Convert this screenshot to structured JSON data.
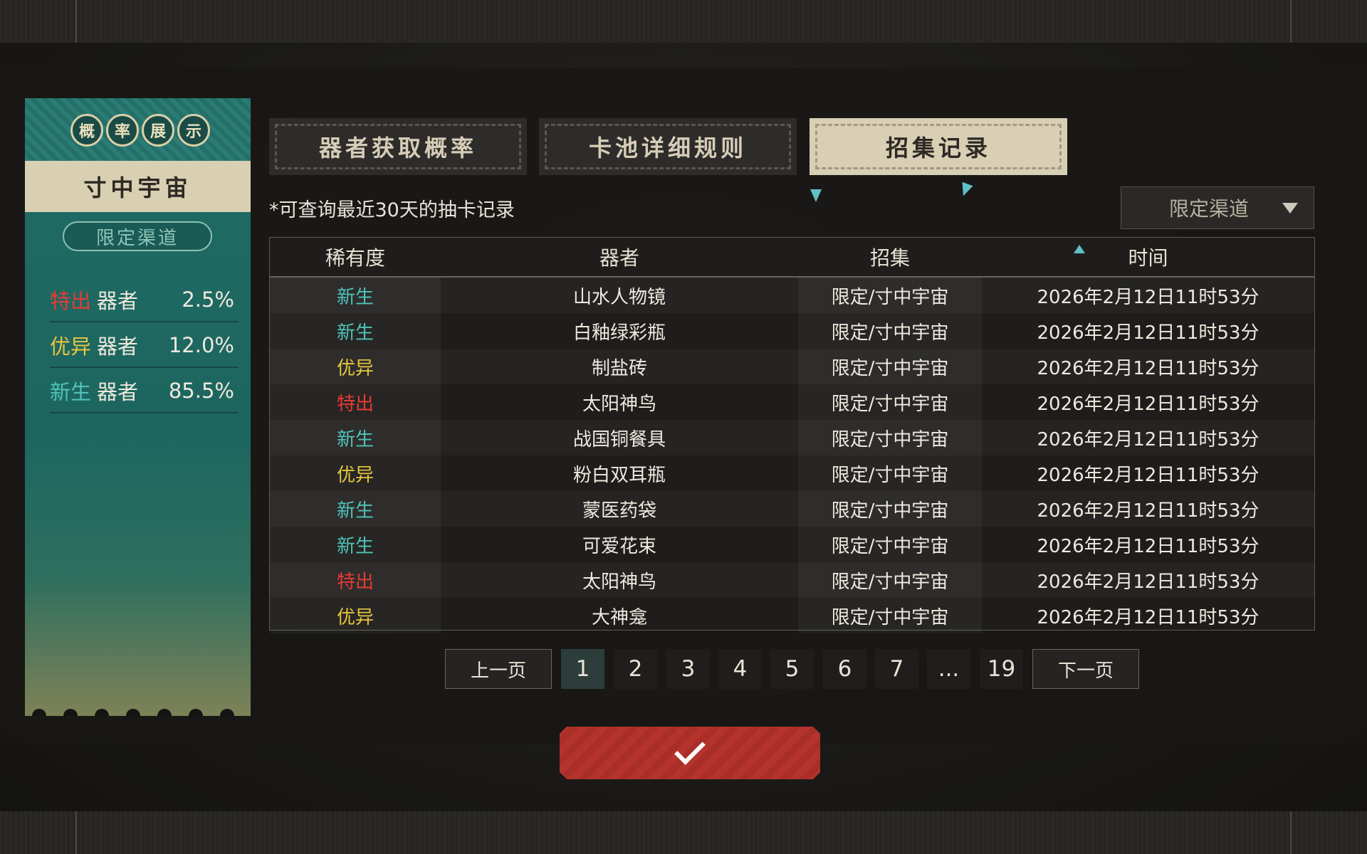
{
  "left_panel": {
    "orbs": [
      "概",
      "率",
      "展",
      "示"
    ],
    "pool_name": "寸中宇宙",
    "channel": "限定渠道",
    "rates": [
      {
        "rarity": "特出",
        "noun": "器者",
        "value": "2.5%"
      },
      {
        "rarity": "优异",
        "noun": "器者",
        "value": "12.0%"
      },
      {
        "rarity": "新生",
        "noun": "器者",
        "value": "85.5%"
      }
    ]
  },
  "tabs": [
    {
      "label": "器者获取概率",
      "active": false
    },
    {
      "label": "卡池详细规则",
      "active": false
    },
    {
      "label": "招集记录",
      "active": true
    }
  ],
  "note": "*可查询最近30天的抽卡记录",
  "channel_select": {
    "selected": "限定渠道"
  },
  "table": {
    "headers": [
      "稀有度",
      "器者",
      "招集",
      "时间"
    ],
    "rows": [
      {
        "rarity": "新生",
        "name": "山水人物镜",
        "pool": "限定/寸中宇宙",
        "time": "2026年2月12日11时53分"
      },
      {
        "rarity": "新生",
        "name": "白釉绿彩瓶",
        "pool": "限定/寸中宇宙",
        "time": "2026年2月12日11时53分"
      },
      {
        "rarity": "优异",
        "name": "制盐砖",
        "pool": "限定/寸中宇宙",
        "time": "2026年2月12日11时53分"
      },
      {
        "rarity": "特出",
        "name": "太阳神鸟",
        "pool": "限定/寸中宇宙",
        "time": "2026年2月12日11时53分"
      },
      {
        "rarity": "新生",
        "name": "战国铜餐具",
        "pool": "限定/寸中宇宙",
        "time": "2026年2月12日11时53分"
      },
      {
        "rarity": "优异",
        "name": "粉白双耳瓶",
        "pool": "限定/寸中宇宙",
        "time": "2026年2月12日11时53分"
      },
      {
        "rarity": "新生",
        "name": "蒙医药袋",
        "pool": "限定/寸中宇宙",
        "time": "2026年2月12日11时53分"
      },
      {
        "rarity": "新生",
        "name": "可爱花束",
        "pool": "限定/寸中宇宙",
        "time": "2026年2月12日11时53分"
      },
      {
        "rarity": "特出",
        "name": "太阳神鸟",
        "pool": "限定/寸中宇宙",
        "time": "2026年2月12日11时53分"
      },
      {
        "rarity": "优异",
        "name": "大神龛",
        "pool": "限定/寸中宇宙",
        "time": "2026年2月12日11时53分"
      }
    ]
  },
  "pagination": {
    "prev": "上一页",
    "next": "下一页",
    "pages": [
      "1",
      "2",
      "3",
      "4",
      "5",
      "6",
      "7",
      "...",
      "19"
    ],
    "current": "1"
  },
  "colors": {
    "rarity_新生": "#4fc3b8",
    "rarity_优异": "#e8c640",
    "rarity_特出": "#e83a34",
    "confirm": "#b4332d",
    "panel_teal": "#1f6b64"
  },
  "icons": {
    "confirm": "check-icon",
    "dropdown": "triangle-down-icon"
  }
}
